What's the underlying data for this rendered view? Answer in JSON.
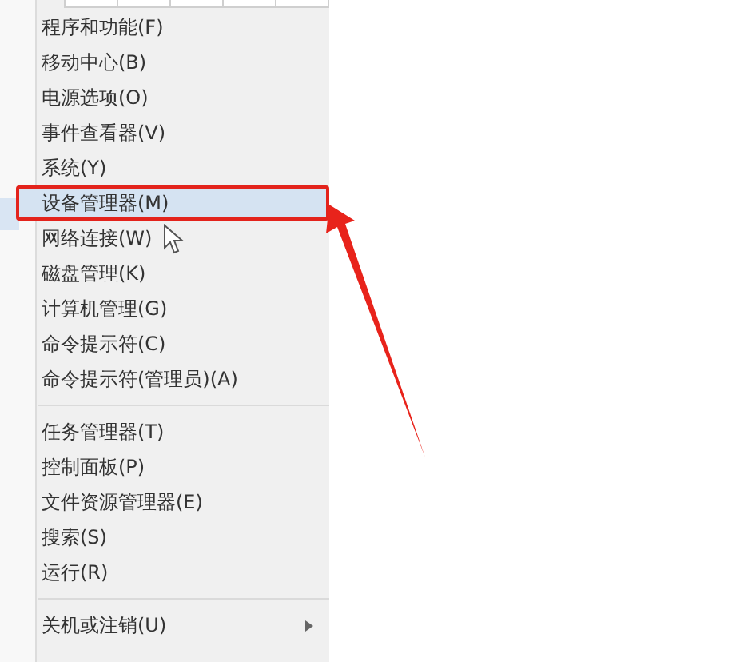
{
  "menu": {
    "sections": [
      [
        {
          "label": "程序和功能(F)",
          "selected": false,
          "has_submenu": false
        },
        {
          "label": "移动中心(B)",
          "selected": false,
          "has_submenu": false
        },
        {
          "label": "电源选项(O)",
          "selected": false,
          "has_submenu": false
        },
        {
          "label": "事件查看器(V)",
          "selected": false,
          "has_submenu": false
        },
        {
          "label": "系统(Y)",
          "selected": false,
          "has_submenu": false
        },
        {
          "label": "设备管理器(M)",
          "selected": true,
          "has_submenu": false
        },
        {
          "label": "网络连接(W)",
          "selected": false,
          "has_submenu": false
        },
        {
          "label": "磁盘管理(K)",
          "selected": false,
          "has_submenu": false
        },
        {
          "label": "计算机管理(G)",
          "selected": false,
          "has_submenu": false
        },
        {
          "label": "命令提示符(C)",
          "selected": false,
          "has_submenu": false
        },
        {
          "label": "命令提示符(管理员)(A)",
          "selected": false,
          "has_submenu": false
        }
      ],
      [
        {
          "label": "任务管理器(T)",
          "selected": false,
          "has_submenu": false
        },
        {
          "label": "控制面板(P)",
          "selected": false,
          "has_submenu": false
        },
        {
          "label": "文件资源管理器(E)",
          "selected": false,
          "has_submenu": false
        },
        {
          "label": "搜索(S)",
          "selected": false,
          "has_submenu": false
        },
        {
          "label": "运行(R)",
          "selected": false,
          "has_submenu": false
        }
      ],
      [
        {
          "label": "关机或注销(U)",
          "selected": false,
          "has_submenu": true
        }
      ]
    ]
  }
}
